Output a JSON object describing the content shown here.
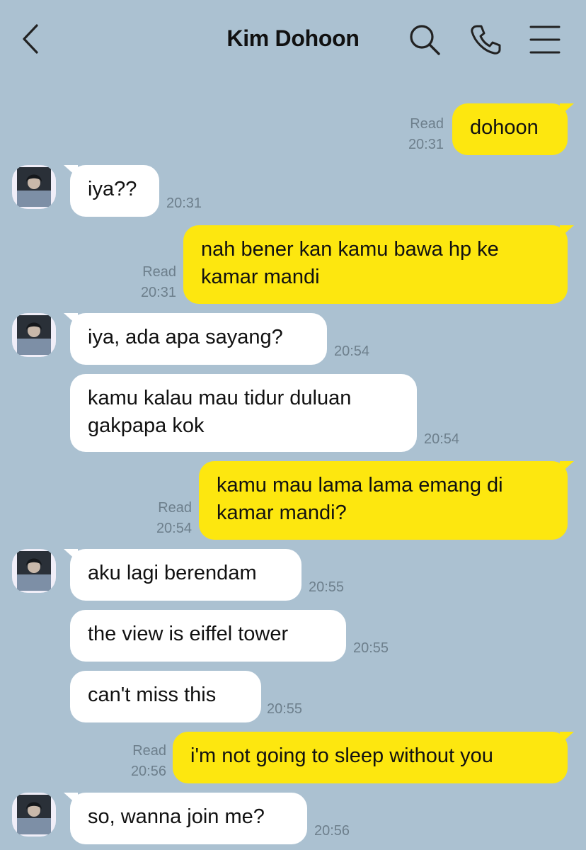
{
  "header": {
    "title": "Kim Dohoon",
    "back_icon": "chevron-left-icon",
    "icons": [
      "search-icon",
      "phone-icon",
      "menu-icon"
    ]
  },
  "colors": {
    "background": "#abc1d1",
    "incoming_bubble": "#ffffff",
    "outgoing_bubble": "#fde70f",
    "meta_text": "#6d7f8c"
  },
  "messages": [
    {
      "dir": "out",
      "text": "dohoon",
      "read": "Read",
      "time": "20:31"
    },
    {
      "dir": "in",
      "text": "iya??",
      "time": "20:31"
    },
    {
      "dir": "out",
      "text": "nah bener kan kamu bawa hp ke kamar mandi",
      "line1": "nah bener kan kamu bawa hp ke",
      "line2": "kamar mandi",
      "read": "Read",
      "time": "20:31"
    },
    {
      "dir": "in",
      "text": "iya, ada apa sayang?",
      "time": "20:54"
    },
    {
      "dir": "in",
      "text": "kamu kalau mau tidur duluan gakpapa kok",
      "line1": "kamu kalau mau tidur duluan",
      "line2": "gakpapa kok",
      "time": "20:54"
    },
    {
      "dir": "out",
      "text": "kamu mau lama lama emang di kamar mandi?",
      "line1": "kamu mau lama lama emang di",
      "line2": "kamar mandi?",
      "read": "Read",
      "time": "20:54"
    },
    {
      "dir": "in",
      "text": "aku lagi berendam",
      "time": "20:55"
    },
    {
      "dir": "in",
      "text": "the view is eiffel tower",
      "time": "20:55"
    },
    {
      "dir": "in",
      "text": "can't miss this",
      "time": "20:55"
    },
    {
      "dir": "out",
      "text": "i'm not going to sleep without you",
      "read": "Read",
      "time": "20:56"
    },
    {
      "dir": "in",
      "text": "so, wanna join me?",
      "time": "20:56"
    }
  ]
}
